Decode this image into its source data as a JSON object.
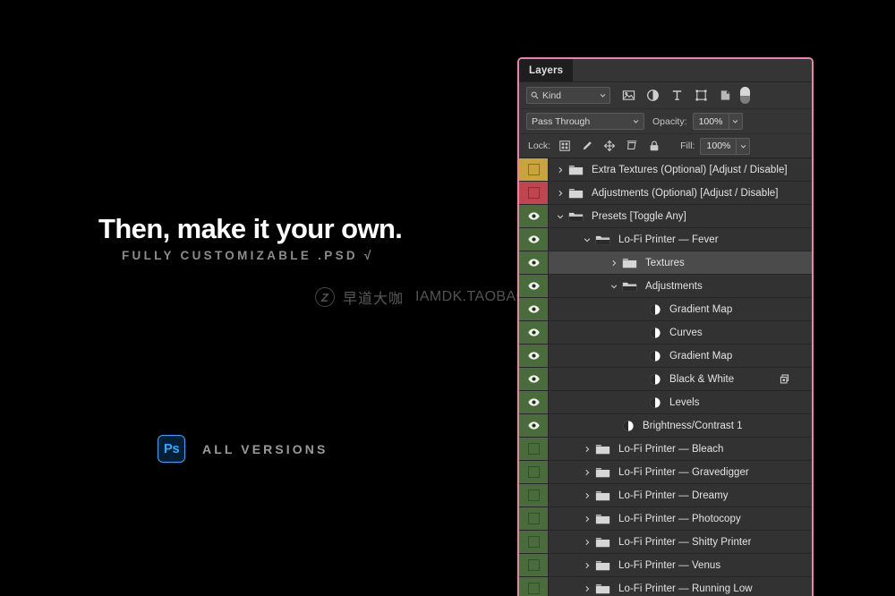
{
  "promo": {
    "headline": "Then, make it your own.",
    "subhead": "FULLY CUSTOMIZABLE .PSD √",
    "app_badge": "Ps",
    "versions_label": "ALL VERSIONS"
  },
  "watermark": {
    "logo": "Z",
    "chinese": "早道大咖",
    "url": "IAMDK.TAOBAO.COM"
  },
  "panel": {
    "border_color": "#ef7fae",
    "tab_label": "Layers",
    "filter": {
      "search_icon": "search-icon",
      "kind_value": "Kind",
      "icons": [
        "pixel-layer-filter-icon",
        "adjustment-layer-filter-icon",
        "type-layer-filter-icon",
        "shape-layer-filter-icon",
        "smart-object-filter-icon"
      ],
      "toggle": "filter-enable-toggle"
    },
    "blend": {
      "mode_value": "Pass Through",
      "opacity_label": "Opacity:",
      "opacity_value": "100%"
    },
    "lock": {
      "lock_label": "Lock:",
      "icons": [
        "lock-transparent-pixels-icon",
        "lock-image-pixels-icon",
        "lock-position-icon",
        "lock-artboard-nesting-icon",
        "lock-all-icon"
      ],
      "fill_label": "Fill:",
      "fill_value": "100%"
    },
    "layers": [
      {
        "name": "Extra Textures (Optional) [Adjust / Disable]",
        "type": "folder",
        "visible": false,
        "swatch": "gold",
        "indent": 0,
        "expanded": false,
        "selected": false,
        "clipped": false
      },
      {
        "name": "Adjustments (Optional) [Adjust / Disable]",
        "type": "folder",
        "visible": false,
        "swatch": "red",
        "indent": 0,
        "expanded": false,
        "selected": false,
        "clipped": false
      },
      {
        "name": "Presets [Toggle Any]",
        "type": "folder",
        "visible": true,
        "swatch": "green",
        "indent": 0,
        "expanded": true,
        "selected": false,
        "clipped": false
      },
      {
        "name": "Lo-Fi Printer — Fever",
        "type": "folder",
        "visible": true,
        "swatch": "green",
        "indent": 1,
        "expanded": true,
        "selected": false,
        "clipped": false
      },
      {
        "name": "Textures",
        "type": "folder",
        "visible": true,
        "swatch": "green",
        "indent": 2,
        "expanded": false,
        "selected": true,
        "clipped": false
      },
      {
        "name": "Adjustments",
        "type": "folder",
        "visible": true,
        "swatch": "green",
        "indent": 2,
        "expanded": true,
        "selected": false,
        "clipped": false
      },
      {
        "name": "Gradient Map",
        "type": "adjustment",
        "visible": true,
        "swatch": "green",
        "indent": 3,
        "expanded": null,
        "selected": false,
        "clipped": false
      },
      {
        "name": "Curves",
        "type": "adjustment",
        "visible": true,
        "swatch": "green",
        "indent": 3,
        "expanded": null,
        "selected": false,
        "clipped": false
      },
      {
        "name": "Gradient Map",
        "type": "adjustment",
        "visible": true,
        "swatch": "green",
        "indent": 3,
        "expanded": null,
        "selected": false,
        "clipped": false
      },
      {
        "name": "Black & White",
        "type": "adjustment",
        "visible": true,
        "swatch": "green",
        "indent": 3,
        "expanded": null,
        "selected": false,
        "clipped": true
      },
      {
        "name": "Levels",
        "type": "adjustment",
        "visible": true,
        "swatch": "green",
        "indent": 3,
        "expanded": null,
        "selected": false,
        "clipped": false
      },
      {
        "name": "Brightness/Contrast 1",
        "type": "adjustment",
        "visible": true,
        "swatch": "green",
        "indent": 2,
        "expanded": null,
        "selected": false,
        "clipped": false
      },
      {
        "name": "Lo-Fi Printer — Bleach",
        "type": "folder",
        "visible": false,
        "swatch": "green",
        "indent": 1,
        "expanded": false,
        "selected": false,
        "clipped": false
      },
      {
        "name": "Lo-Fi Printer — Gravedigger",
        "type": "folder",
        "visible": false,
        "swatch": "green",
        "indent": 1,
        "expanded": false,
        "selected": false,
        "clipped": false
      },
      {
        "name": "Lo-Fi Printer — Dreamy",
        "type": "folder",
        "visible": false,
        "swatch": "green",
        "indent": 1,
        "expanded": false,
        "selected": false,
        "clipped": false
      },
      {
        "name": "Lo-Fi Printer — Photocopy",
        "type": "folder",
        "visible": false,
        "swatch": "green",
        "indent": 1,
        "expanded": false,
        "selected": false,
        "clipped": false
      },
      {
        "name": "Lo-Fi Printer — Shitty Printer",
        "type": "folder",
        "visible": false,
        "swatch": "green",
        "indent": 1,
        "expanded": false,
        "selected": false,
        "clipped": false
      },
      {
        "name": "Lo-Fi Printer — Venus",
        "type": "folder",
        "visible": false,
        "swatch": "green",
        "indent": 1,
        "expanded": false,
        "selected": false,
        "clipped": false
      },
      {
        "name": "Lo-Fi Printer — Running Low",
        "type": "folder",
        "visible": false,
        "swatch": "green",
        "indent": 1,
        "expanded": false,
        "selected": false,
        "clipped": false
      }
    ]
  }
}
